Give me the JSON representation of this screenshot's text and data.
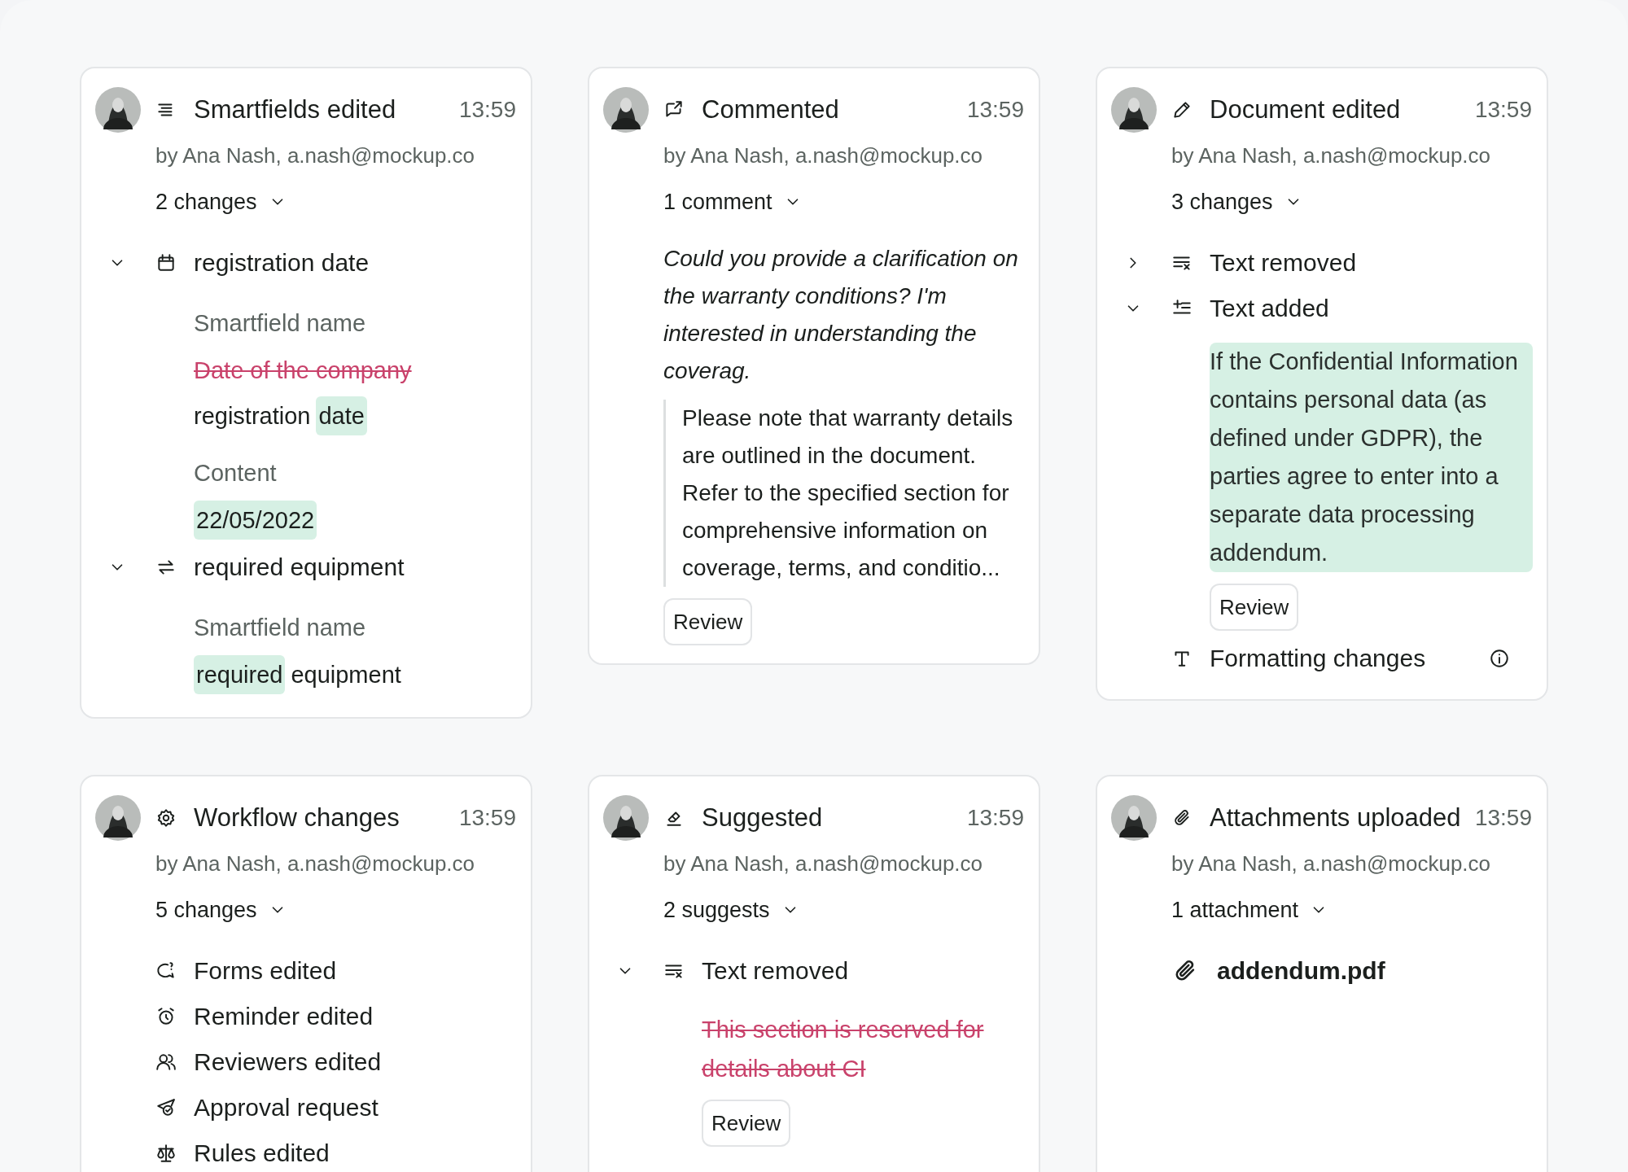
{
  "cards": [
    {
      "kind": "smartfields",
      "title": "Smartfields edited",
      "time": "13:59",
      "author": "by Ana Nash, a.nash@mockup.co",
      "summary": {
        "text": "2 changes",
        "expanded": true
      },
      "entries": [
        {
          "kind": "date-field",
          "label": "registration date",
          "expanded": true,
          "details": [
            {
              "kind": "label",
              "text": "Smartfield name"
            },
            {
              "kind": "line",
              "segments": [
                {
                  "kind": "removed",
                  "text": "Date of the company"
                }
              ]
            },
            {
              "kind": "line",
              "segments": [
                {
                  "kind": "plain",
                  "text": "registration"
                },
                {
                  "kind": "added",
                  "text": "date"
                }
              ]
            },
            {
              "kind": "label",
              "text": "Content"
            },
            {
              "kind": "line",
              "segments": [
                {
                  "kind": "added",
                  "text": "22/05/2022"
                }
              ]
            }
          ]
        },
        {
          "kind": "choice-field",
          "label": "required equipment",
          "expanded": true,
          "details": [
            {
              "kind": "label",
              "text": "Smartfield name"
            },
            {
              "kind": "line",
              "segments": [
                {
                  "kind": "added",
                  "text": "required"
                },
                {
                  "kind": "plain",
                  "text": "equipment"
                }
              ]
            }
          ]
        }
      ]
    },
    {
      "kind": "comment",
      "title": "Commented",
      "time": "13:59",
      "author": "by Ana Nash, a.nash@mockup.co",
      "summary": {
        "text": "1 comment",
        "expanded": true
      },
      "entries": [
        {
          "kind": "comment",
          "text": "Could you provide a clarification on the warranty conditions? I'm interested in understanding the coverag."
        },
        {
          "kind": "quote",
          "text": "Please note that warranty details are outlined in the document. Refer to the specified section for comprehensive information on coverage, terms, and conditio..."
        },
        {
          "kind": "button",
          "text": "Review"
        }
      ]
    },
    {
      "kind": "document",
      "title": "Document edited",
      "time": "13:59",
      "author": "by Ana Nash, a.nash@mockup.co",
      "summary": {
        "text": "3 changes",
        "expanded": true
      },
      "entries": [
        {
          "kind": "text-removed",
          "label": "Text removed",
          "expanded": false
        },
        {
          "kind": "text-added",
          "label": "Text added",
          "expanded": true,
          "details": [
            {
              "kind": "added-block",
              "text": "If the Confidential Information contains personal data (as defined under GDPR), the parties agree to enter into a separate data processing addendum."
            },
            {
              "kind": "button",
              "text": "Review"
            }
          ]
        },
        {
          "kind": "formatting",
          "label": "Formatting changes"
        }
      ]
    },
    {
      "kind": "workflow",
      "title": "Workflow changes",
      "time": "13:59",
      "author": "by Ana Nash, a.nash@mockup.co",
      "summary": {
        "text": "5 changes",
        "expanded": true
      },
      "entries": [
        {
          "kind": "forms",
          "label": "Forms edited"
        },
        {
          "kind": "reminder",
          "label": "Reminder edited"
        },
        {
          "kind": "reviewers",
          "label": "Reviewers edited"
        },
        {
          "kind": "approval",
          "label": "Approval request"
        },
        {
          "kind": "rules",
          "label": "Rules edited"
        }
      ]
    },
    {
      "kind": "suggestion",
      "title": "Suggested",
      "time": "13:59",
      "author": "by Ana Nash, a.nash@mockup.co",
      "summary": {
        "text": "2 suggests",
        "expanded": true
      },
      "entries": [
        {
          "kind": "text-removed",
          "label": "Text removed",
          "expanded": true,
          "details": [
            {
              "kind": "removed-block",
              "text": "This section is reserved for details about CI"
            },
            {
              "kind": "button",
              "text": "Review"
            }
          ]
        }
      ]
    },
    {
      "kind": "attachments",
      "title": "Attachments uploaded",
      "time": "13:59",
      "author": "by Ana Nash, a.nash@mockup.co",
      "summary": {
        "text": "1 attachment",
        "expanded": true
      },
      "entries": [
        {
          "kind": "file",
          "name": "addendum.pdf"
        }
      ]
    }
  ]
}
